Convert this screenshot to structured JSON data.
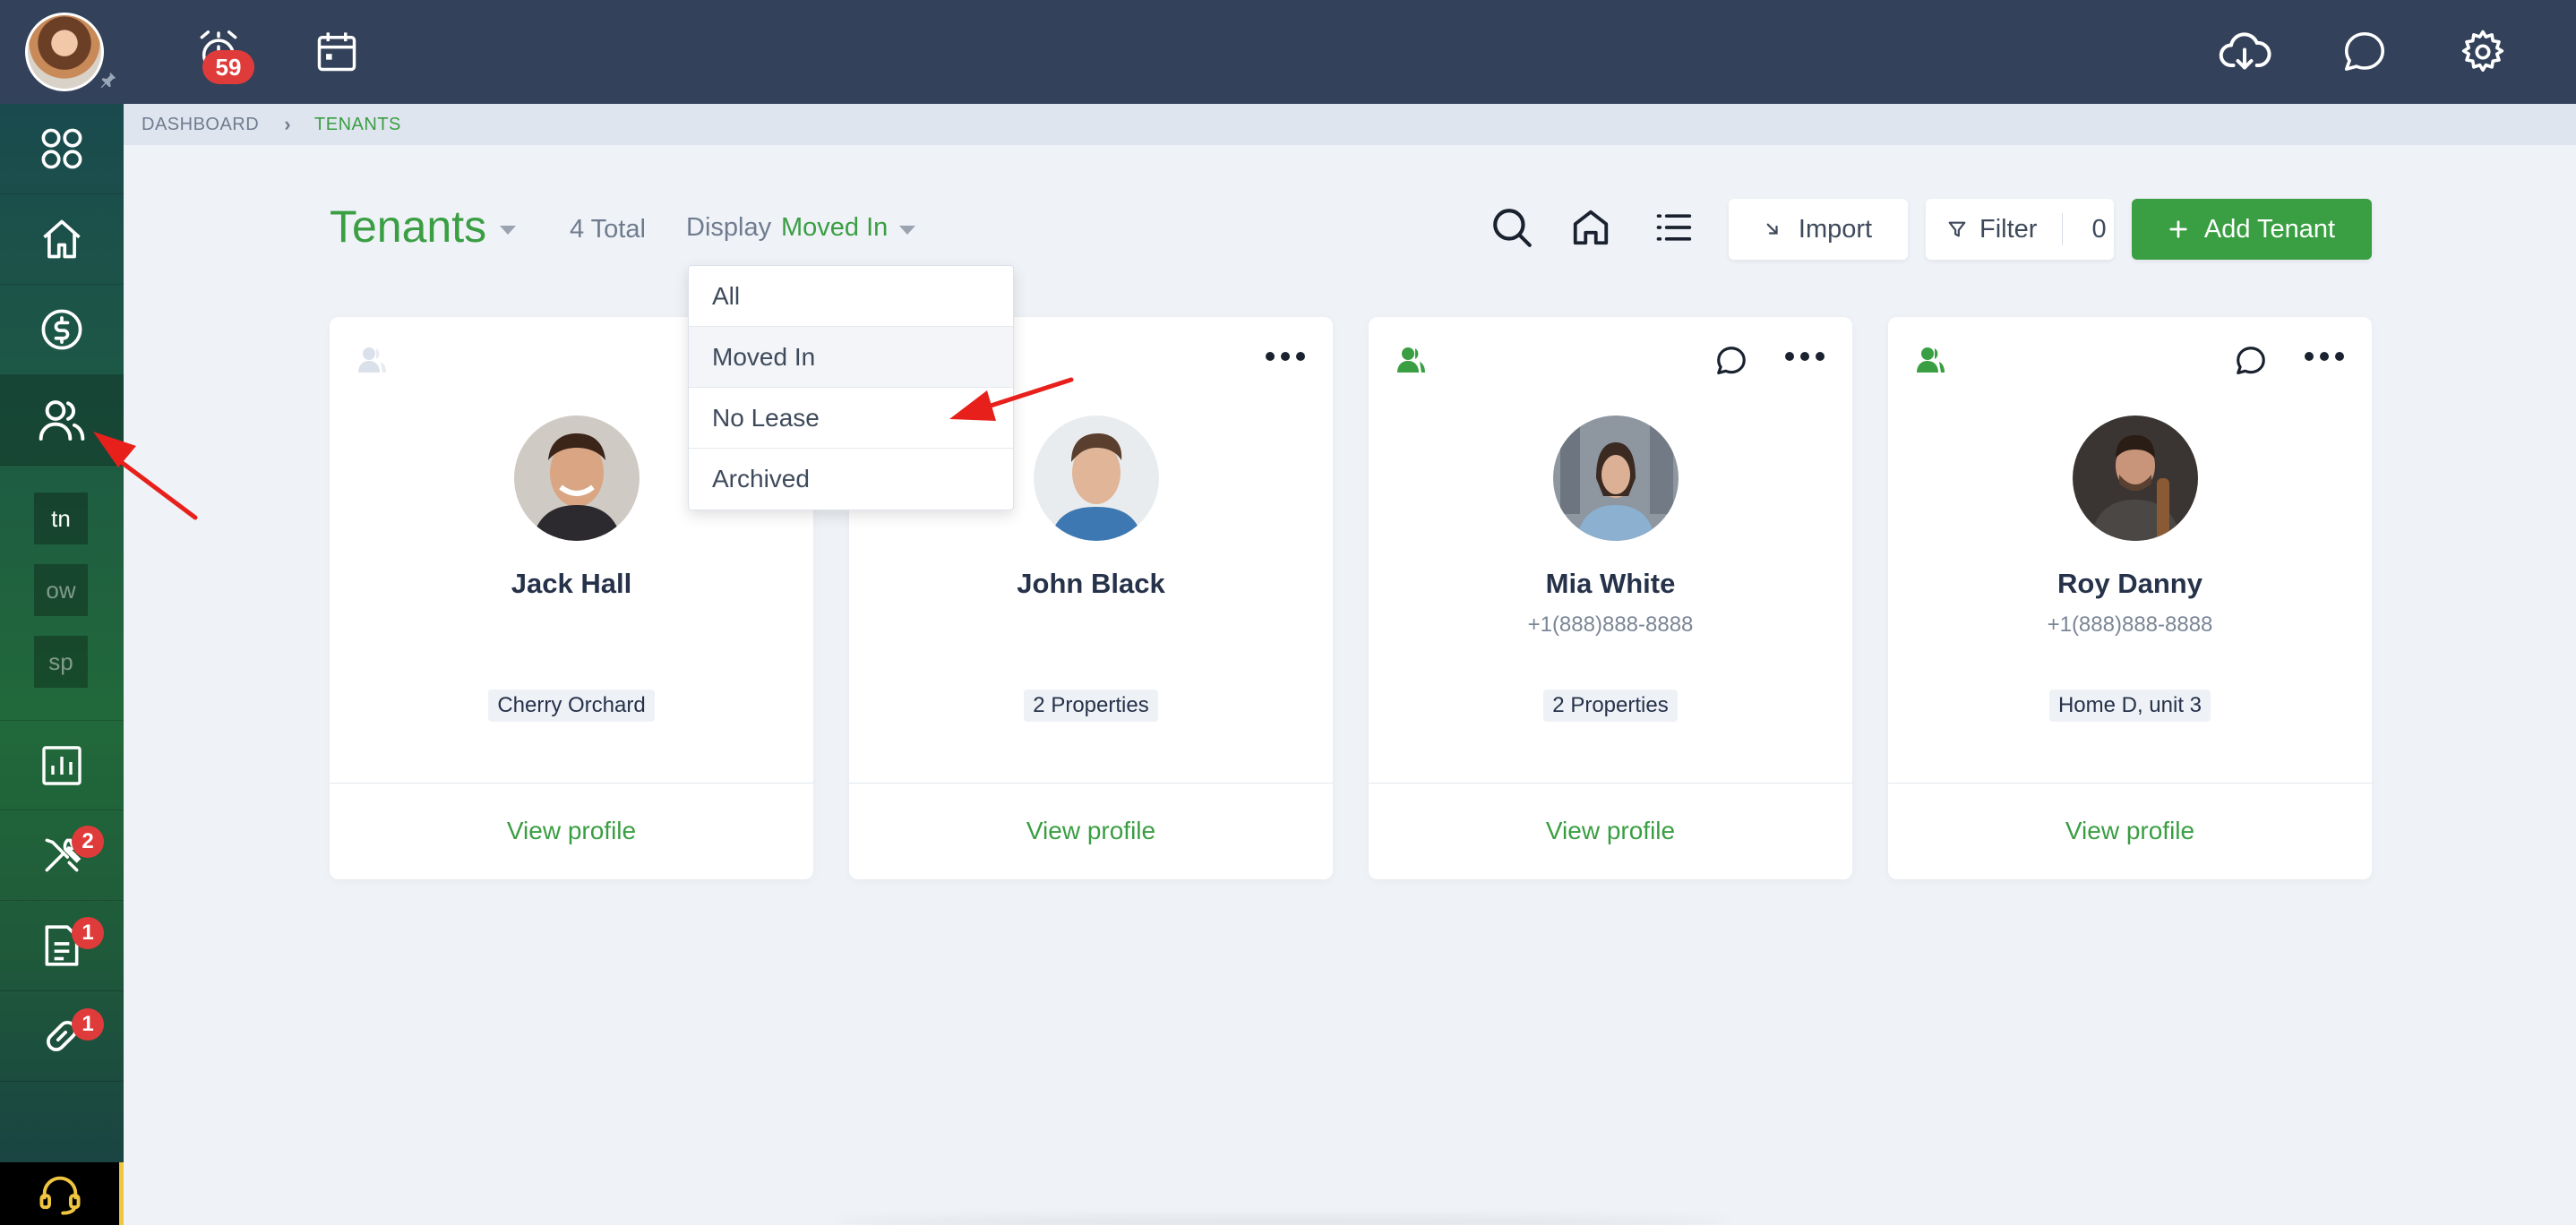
{
  "topbar": {
    "alarm_count": "59",
    "icons": [
      "alarm-icon",
      "calendar-icon",
      "cloud-download-icon",
      "chat-icon",
      "gear-icon"
    ]
  },
  "sidebar": {
    "items": [
      "dashboard-icon",
      "home-icon",
      "money-icon",
      "people-icon",
      "chart-icon",
      "tools-icon",
      "document-icon",
      "link-icon"
    ],
    "sub_items": [
      "tn",
      "ow",
      "sp"
    ],
    "badges": {
      "tools": "2",
      "documents": "1",
      "links": "1"
    }
  },
  "breadcrumb": {
    "items": [
      "DASHBOARD",
      "TENANTS"
    ]
  },
  "header": {
    "title": "Tenants",
    "total": "4 Total",
    "display_label": "Display",
    "display_value": "Moved In"
  },
  "toolbar": {
    "import_label": "Import",
    "filter_label": "Filter",
    "filter_count": "0",
    "add_label": "Add Tenant"
  },
  "dropdown": {
    "options": [
      "All",
      "Moved In",
      "No Lease",
      "Archived"
    ],
    "selected": "Moved In"
  },
  "tenants": [
    {
      "name": "Jack Hall",
      "phone": "",
      "property": "Cherry Orchard",
      "view": "View profile"
    },
    {
      "name": "John Black",
      "phone": "",
      "property": "2 Properties",
      "view": "View profile"
    },
    {
      "name": "Mia White",
      "phone": "+1(888)888-8888",
      "property": "2 Properties",
      "view": "View profile"
    },
    {
      "name": "Roy Danny",
      "phone": "+1(888)888-8888",
      "property": "Home D, unit 3",
      "view": "View profile"
    }
  ],
  "colors": {
    "brand_green": "#3a9e43",
    "topbar": "#33425a",
    "badge_red": "#e03b3b",
    "annotation_red": "#e8201c"
  }
}
